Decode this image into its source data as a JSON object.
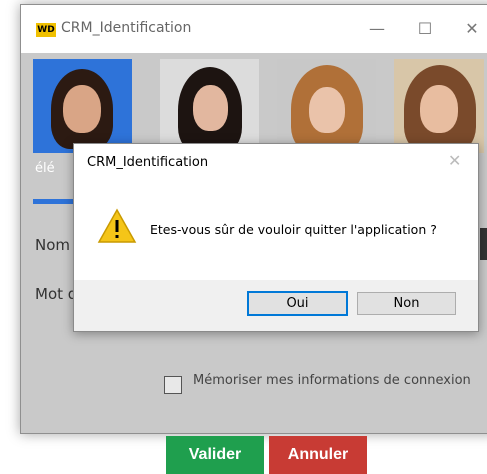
{
  "window": {
    "title": "CRM_Identification",
    "logo_text": "WD",
    "minimize_glyph": "—",
    "maximize_glyph": "☐",
    "close_glyph": "✕"
  },
  "login": {
    "selected_user_label": "élé",
    "name_label": "Nom",
    "password_label": "Mot d",
    "remember_label": "Mémoriser mes informations de connexion",
    "validate_label": "Valider",
    "cancel_label": "Annuler"
  },
  "dialog": {
    "title": "CRM_Identification",
    "close_glyph": "✕",
    "message": "Etes-vous sûr de vouloir quitter l'application ?",
    "icon": "warning-icon",
    "yes_label": "Oui",
    "no_label": "Non"
  },
  "colors": {
    "validate": "#1f9f4e",
    "cancel": "#c83b34",
    "selection": "#2e73d9",
    "warning": "#f5c518"
  }
}
